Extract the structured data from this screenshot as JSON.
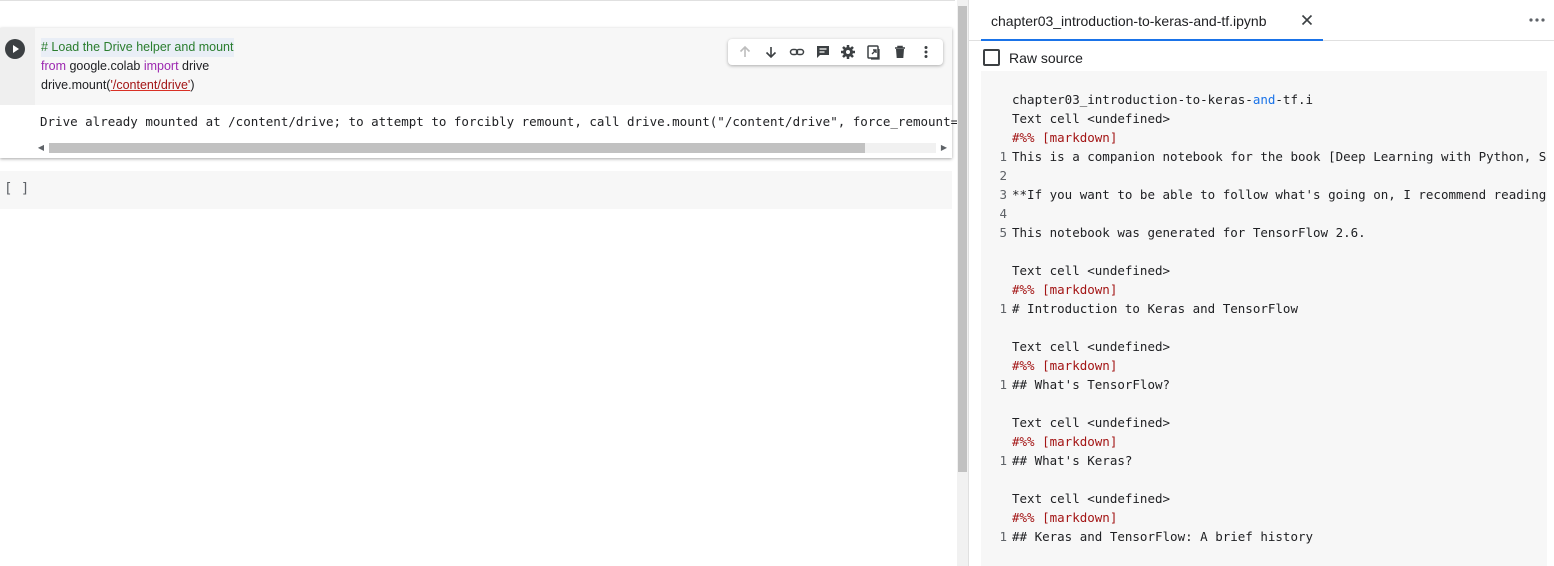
{
  "notebook": {
    "cell1": {
      "code_lines": [
        "# Load the Drive helper and mount",
        "from google.colab import drive",
        "drive.mount('/content/drive')"
      ],
      "output": "Drive already mounted at /content/drive; to attempt to forcibly remount, call drive.mount(\"/content/drive\", force_remount=True)."
    },
    "cell2": {
      "label": "[ ]"
    },
    "toolbar_icons": [
      "move-up-icon",
      "move-down-icon",
      "link-icon",
      "comment-icon",
      "settings-icon",
      "mirror-cell-icon",
      "delete-icon",
      "more-vert-icon"
    ]
  },
  "side_panel": {
    "tab_title": "chapter03_introduction-to-keras-and-tf.ipynb",
    "raw_source_label": "Raw source",
    "raw_source_checked": false,
    "source_title_prefix": "chapter03_introduction-to-keras-",
    "source_title_and": "and",
    "source_title_suffix": "-tf.i",
    "blocks": [
      {
        "header": "Text cell <undefined>",
        "marker": "#%% [markdown]",
        "lines": [
          {
            "num": "1",
            "text": "This is a companion notebook for the book [Deep Learning with Python, Second Edition]"
          },
          {
            "num": "2",
            "text": ""
          },
          {
            "num": "3",
            "text": "**If you want to be able to follow what's going on, I recommend reading the notebook"
          },
          {
            "num": "4",
            "text": ""
          },
          {
            "num": "5",
            "text": "This notebook was generated for TensorFlow 2.6."
          }
        ]
      },
      {
        "header": "Text cell <undefined>",
        "marker": "#%% [markdown]",
        "lines": [
          {
            "num": "1",
            "text": "# Introduction to Keras and TensorFlow"
          }
        ]
      },
      {
        "header": "Text cell <undefined>",
        "marker": "#%% [markdown]",
        "lines": [
          {
            "num": "1",
            "text": "## What's TensorFlow?"
          }
        ]
      },
      {
        "header": "Text cell <undefined>",
        "marker": "#%% [markdown]",
        "lines": [
          {
            "num": "1",
            "text": "## What's Keras?"
          }
        ]
      },
      {
        "header": "Text cell <undefined>",
        "marker": "#%% [markdown]",
        "lines": [
          {
            "num": "1",
            "text": "## Keras and TensorFlow: A brief history"
          }
        ]
      }
    ]
  },
  "colors": {
    "accent": "#1a73e8",
    "comment": "#2a7d2e",
    "keyword": "#9c27b0",
    "string": "#a31515"
  }
}
